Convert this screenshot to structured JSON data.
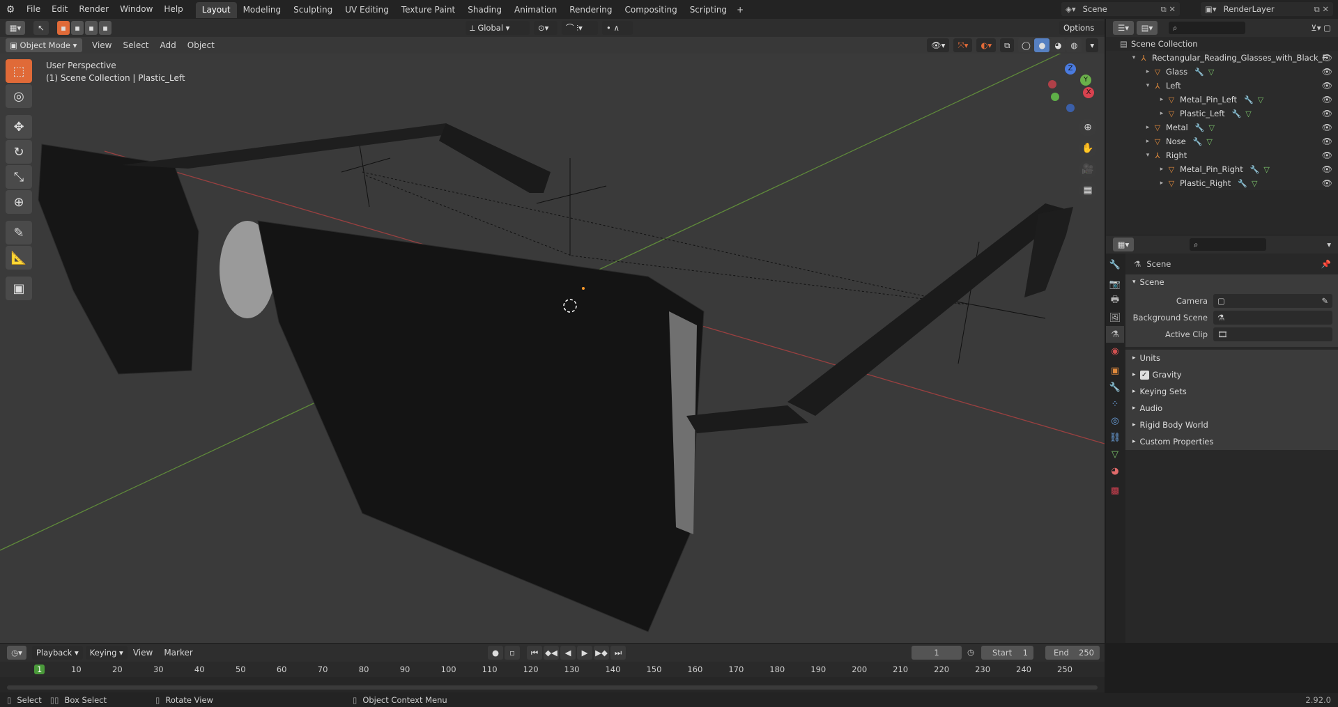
{
  "topbar": {
    "menus": [
      "File",
      "Edit",
      "Render",
      "Window",
      "Help"
    ],
    "workspaces": [
      "Layout",
      "Modeling",
      "Sculpting",
      "UV Editing",
      "Texture Paint",
      "Shading",
      "Animation",
      "Rendering",
      "Compositing",
      "Scripting"
    ],
    "active_workspace": "Layout",
    "add_tab": "+",
    "scene": "Scene",
    "view_layer": "RenderLayer"
  },
  "viewport": {
    "mode": "Object Mode",
    "menus": [
      "View",
      "Select",
      "Add",
      "Object"
    ],
    "orientation": "Global",
    "options": "Options",
    "perspective": "User Perspective",
    "collection": "(1) Scene Collection | Plastic_Left",
    "gizmo": {
      "x": "X",
      "y": "Y",
      "z": "Z"
    }
  },
  "outliner": {
    "root": "Scene Collection",
    "items": [
      {
        "label": "Rectangular_Reading_Glasses_with_Black_F",
        "indent": 1,
        "expanded": true,
        "type": "empty"
      },
      {
        "label": "Glass",
        "indent": 2,
        "expanded": false,
        "type": "mesh"
      },
      {
        "label": "Left",
        "indent": 2,
        "expanded": true,
        "type": "empty"
      },
      {
        "label": "Metal_Pin_Left",
        "indent": 3,
        "expanded": false,
        "type": "mesh"
      },
      {
        "label": "Plastic_Left",
        "indent": 3,
        "expanded": false,
        "type": "mesh"
      },
      {
        "label": "Metal",
        "indent": 2,
        "expanded": false,
        "type": "mesh"
      },
      {
        "label": "Nose",
        "indent": 2,
        "expanded": false,
        "type": "mesh"
      },
      {
        "label": "Right",
        "indent": 2,
        "expanded": true,
        "type": "empty"
      },
      {
        "label": "Metal_Pin_Right",
        "indent": 3,
        "expanded": false,
        "type": "mesh"
      },
      {
        "label": "Plastic_Right",
        "indent": 3,
        "expanded": false,
        "type": "mesh"
      }
    ]
  },
  "properties": {
    "context": "Scene",
    "panel": "Scene",
    "fields": [
      {
        "label": "Camera",
        "value": ""
      },
      {
        "label": "Background Scene",
        "value": ""
      },
      {
        "label": "Active Clip",
        "value": ""
      }
    ],
    "subpanels": [
      "Units",
      "Gravity",
      "Keying Sets",
      "Audio",
      "Rigid Body World",
      "Custom Properties"
    ]
  },
  "timeline": {
    "menus": [
      "Playback",
      "Keying",
      "View",
      "Marker"
    ],
    "current_frame": "1",
    "start_label": "Start",
    "start": "1",
    "end_label": "End",
    "end": "250",
    "ticks": [
      "1",
      "10",
      "20",
      "30",
      "40",
      "50",
      "60",
      "70",
      "80",
      "90",
      "100",
      "110",
      "120",
      "130",
      "140",
      "150",
      "160",
      "170",
      "180",
      "190",
      "200",
      "210",
      "220",
      "230",
      "240",
      "250"
    ]
  },
  "status": {
    "select": "Select",
    "box_select": "Box Select",
    "rotate": "Rotate View",
    "context_menu": "Object Context Menu",
    "version": "2.92.0"
  }
}
